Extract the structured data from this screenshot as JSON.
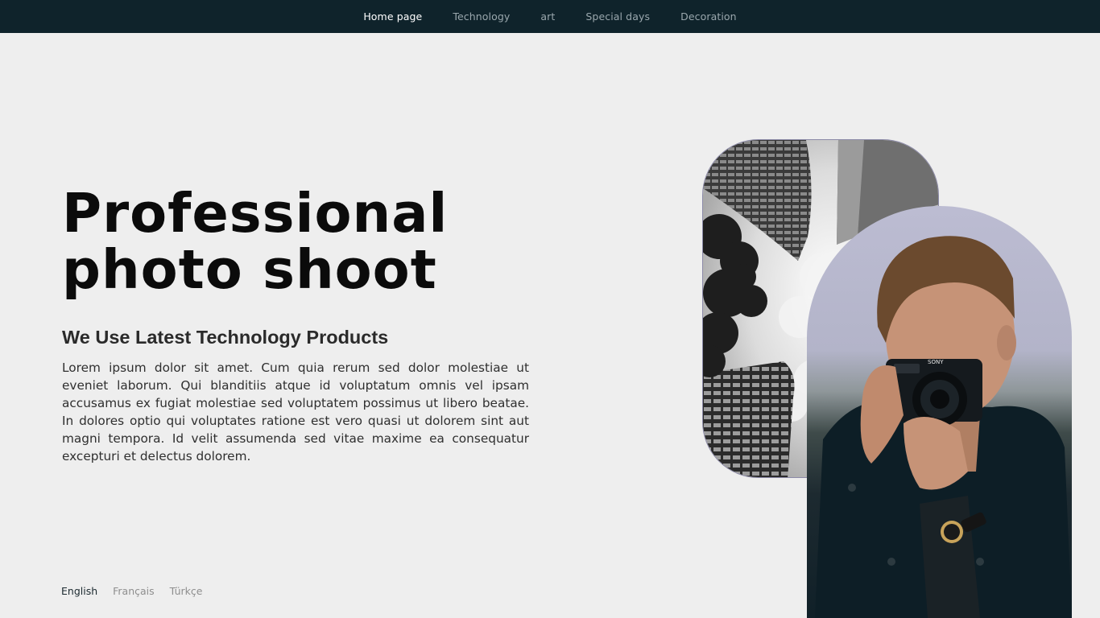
{
  "nav": {
    "items": [
      {
        "label": "Home page",
        "active": true
      },
      {
        "label": "Technology",
        "active": false
      },
      {
        "label": "art",
        "active": false
      },
      {
        "label": "Special days",
        "active": false
      },
      {
        "label": "Decoration",
        "active": false
      }
    ]
  },
  "hero": {
    "title_line1": "Professional",
    "title_line2": "photo shoot",
    "subtitle": "We Use Latest Technology Products",
    "body": "Lorem ipsum dolor sit amet. Cum quia rerum sed dolor molestiae ut eveniet laborum. Qui blanditiis atque id voluptatum omnis vel ipsam accusamus ex fugiat molestiae sed voluptatem possimus ut libero beatae. In dolores optio qui voluptates ratione est vero quasi ut dolorem sint aut magni tempora. Id velit assumenda sed vitae maxime ea consequatur excepturi et delectus dolorem."
  },
  "languages": [
    {
      "label": "English",
      "active": true
    },
    {
      "label": "Français",
      "active": false
    },
    {
      "label": "Türkçe",
      "active": false
    }
  ],
  "images": {
    "camera_brand": "SONY"
  },
  "colors": {
    "topbar_bg": "#0f232b",
    "page_bg": "#eeeeee",
    "nav_active": "#ffffff",
    "nav_inactive": "#9aa7ad"
  }
}
